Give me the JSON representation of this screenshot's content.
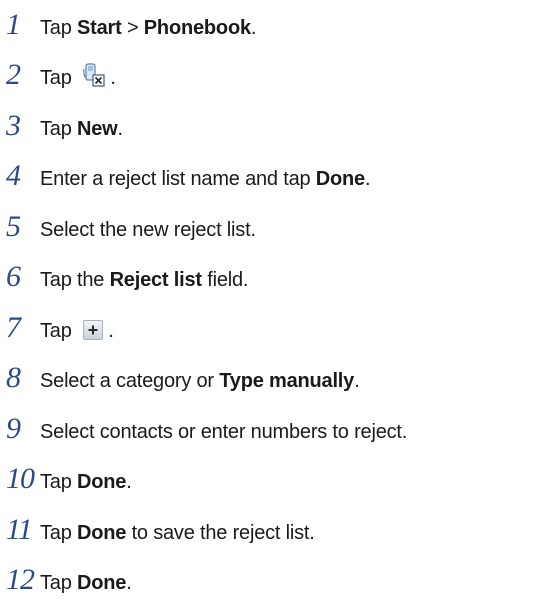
{
  "steps": [
    {
      "num": "1",
      "parts": [
        {
          "t": "Tap "
        },
        {
          "t": "Start",
          "b": true
        },
        {
          "t": " > "
        },
        {
          "t": "Phonebook",
          "b": true
        },
        {
          "t": "."
        }
      ]
    },
    {
      "num": "2",
      "parts": [
        {
          "t": "Tap"
        },
        {
          "icon": "reject-list-icon"
        },
        {
          "t": "."
        }
      ]
    },
    {
      "num": "3",
      "parts": [
        {
          "t": "Tap "
        },
        {
          "t": "New",
          "b": true
        },
        {
          "t": "."
        }
      ]
    },
    {
      "num": "4",
      "parts": [
        {
          "t": "Enter a reject list name and tap "
        },
        {
          "t": "Done",
          "b": true
        },
        {
          "t": "."
        }
      ]
    },
    {
      "num": "5",
      "parts": [
        {
          "t": "Select the new reject list."
        }
      ]
    },
    {
      "num": "6",
      "parts": [
        {
          "t": "Tap the "
        },
        {
          "t": "Reject list",
          "b": true
        },
        {
          "t": " field."
        }
      ]
    },
    {
      "num": "7",
      "parts": [
        {
          "t": "Tap"
        },
        {
          "icon": "plus-icon"
        },
        {
          "t": "."
        }
      ]
    },
    {
      "num": "8",
      "parts": [
        {
          "t": "Select a category or "
        },
        {
          "t": "Type manually",
          "b": true
        },
        {
          "t": "."
        }
      ]
    },
    {
      "num": "9",
      "parts": [
        {
          "t": "Select contacts or enter numbers to reject."
        }
      ]
    },
    {
      "num": "10",
      "parts": [
        {
          "t": "Tap "
        },
        {
          "t": "Done",
          "b": true
        },
        {
          "t": "."
        }
      ]
    },
    {
      "num": "11",
      "parts": [
        {
          "t": "Tap "
        },
        {
          "t": "Done",
          "b": true
        },
        {
          "t": " to save the reject list."
        }
      ]
    },
    {
      "num": "12",
      "parts": [
        {
          "t": "Tap "
        },
        {
          "t": "Done",
          "b": true
        },
        {
          "t": "."
        }
      ]
    }
  ],
  "colors": {
    "step_number": "#2c4a86",
    "text": "#1a1a1a"
  }
}
